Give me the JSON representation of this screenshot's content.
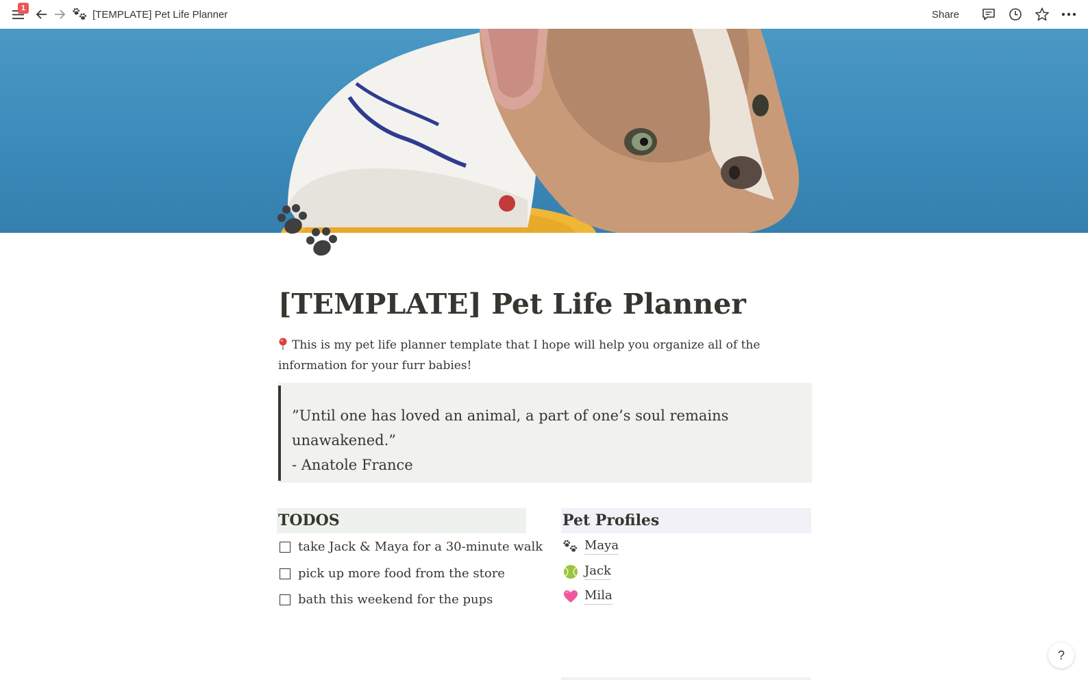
{
  "topbar": {
    "notification_count": "1",
    "breadcrumb_title": "[TEMPLATE] Pet Life Planner",
    "breadcrumb_icon": "paw-prints-icon",
    "share_label": "Share",
    "icons": [
      "menu-icon",
      "back-arrow-icon",
      "forward-arrow-icon",
      "comment-icon",
      "history-clock-icon",
      "star-icon",
      "more-icon"
    ]
  },
  "cover": {
    "description_icon": "dog-photo-cover",
    "background_color": "#3b8bbb"
  },
  "page": {
    "icon": "paw-prints-icon",
    "title": "[TEMPLATE] Pet Life Planner",
    "intro": "This is my pet life planner template that I hope will help you organize all of the information for your furr babies!",
    "intro_icon": "pushpin-icon",
    "quote_line1": "”Until one has loved an animal, a part of one’s soul remains unawakened.”",
    "quote_line2": "- Anatole France"
  },
  "todos": {
    "heading": "TODOS",
    "heading_bg": "#edf3ec",
    "items": [
      {
        "text": "take Jack & Maya for a 30-minute walk",
        "checked": false
      },
      {
        "text": "pick up more food from the store",
        "checked": false
      },
      {
        "text": "bath this weekend for the pups",
        "checked": false
      }
    ]
  },
  "profiles": {
    "heading": "Pet Profiles",
    "heading_bg": "#f2f1f8",
    "items": [
      {
        "label": "Maya",
        "icon": "paw-prints-icon"
      },
      {
        "label": "Jack",
        "icon": "tennis-ball-icon"
      },
      {
        "label": "Mila",
        "icon": "heart-icon"
      }
    ]
  },
  "help_label": "?"
}
